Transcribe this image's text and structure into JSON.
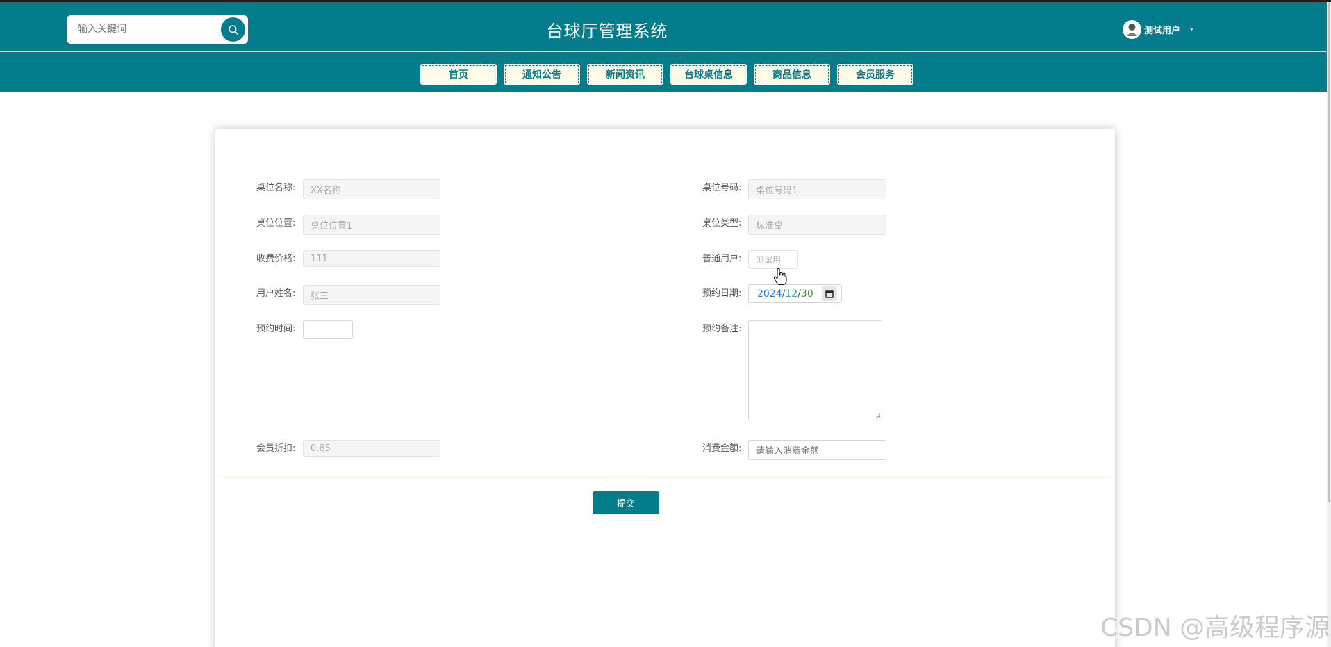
{
  "header": {
    "search_placeholder": "输入关键词",
    "title": "台球厅管理系统",
    "user_name": "测试用户",
    "nav": [
      "首页",
      "通知公告",
      "新闻资讯",
      "台球桌信息",
      "商品信息",
      "会员服务"
    ]
  },
  "form": {
    "table_name": {
      "label": "桌位名称:",
      "value": "XX名称"
    },
    "table_number": {
      "label": "桌位号码:",
      "value": "桌位号码1"
    },
    "table_location": {
      "label": "桌位位置:",
      "value": "桌位位置1"
    },
    "table_type": {
      "label": "桌位类型:",
      "value": "标准桌"
    },
    "price": {
      "label": "收费价格:",
      "value": "111"
    },
    "normal_user": {
      "label": "普通用户:",
      "value": "测试用"
    },
    "user_real_name": {
      "label": "用户姓名:",
      "value": "张三"
    },
    "booking_date": {
      "label": "预约日期:",
      "year": "2024",
      "month": "12",
      "day": "30",
      "separator": "/"
    },
    "booking_time": {
      "label": "预约时间:",
      "value": ""
    },
    "booking_note": {
      "label": "预约备注:",
      "value": ""
    },
    "member_discount": {
      "label": "会员折扣:",
      "value": "0.85"
    },
    "amount": {
      "label": "消费金额:",
      "placeholder": "请输入消费金额"
    },
    "submit_label": "提交"
  },
  "watermark": "CSDN @高级程序源",
  "colors": {
    "primary": "#037d8c",
    "nav_bg": "#fefbe8",
    "divider": "#efc8b0"
  },
  "icons": {
    "search": "search-icon",
    "calendar": "calendar-icon",
    "cursor": "hand-pointer-icon",
    "caret": "caret-down-icon"
  }
}
